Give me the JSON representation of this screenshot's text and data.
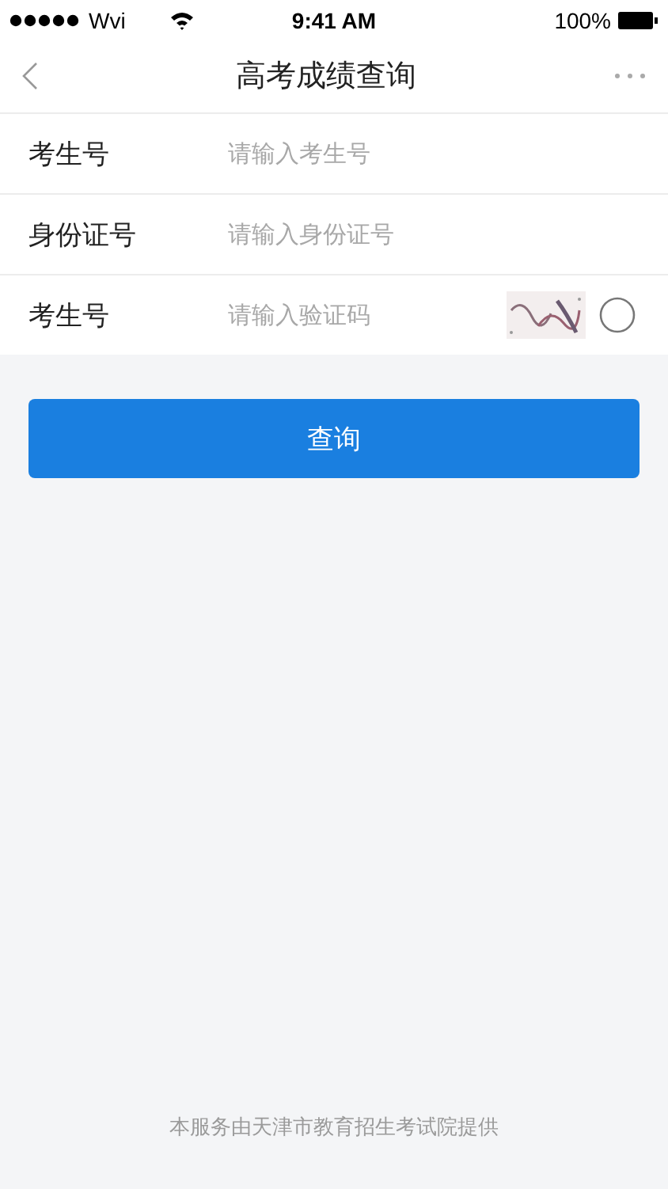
{
  "status_bar": {
    "carrier": "Wvi",
    "time": "9:41 AM",
    "battery": "100%"
  },
  "nav_bar": {
    "title": "高考成绩查询"
  },
  "form": {
    "rows": [
      {
        "kind": "text",
        "label": "考生号",
        "placeholder": "请输入考生号"
      },
      {
        "kind": "text",
        "label": "身份证号",
        "placeholder": "请输入身份证号"
      },
      {
        "kind": "captcha",
        "label": "考生号",
        "placeholder": "请输入验证码"
      }
    ]
  },
  "submit_button": {
    "label": "查询"
  },
  "footer": "本服务由天津市教育招生考试院提供"
}
